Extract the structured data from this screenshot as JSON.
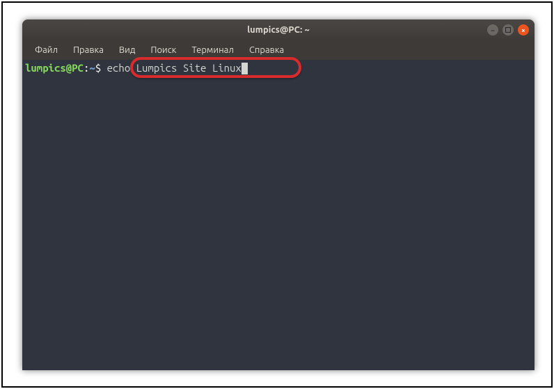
{
  "window": {
    "title": "lumpics@PC: ~"
  },
  "menubar": {
    "items": [
      {
        "label": "Файл"
      },
      {
        "label": "Правка"
      },
      {
        "label": "Вид"
      },
      {
        "label": "Поиск"
      },
      {
        "label": "Терминал"
      },
      {
        "label": "Справка"
      }
    ]
  },
  "terminal": {
    "prompt_user": "lumpics@PC",
    "prompt_separator": ":",
    "prompt_path": "~",
    "prompt_dollar": "$",
    "command": " echo Lumpics Site Linux"
  },
  "controls": {
    "minimize_glyph": "−",
    "maximize_glyph": "□",
    "close_glyph": "×"
  }
}
